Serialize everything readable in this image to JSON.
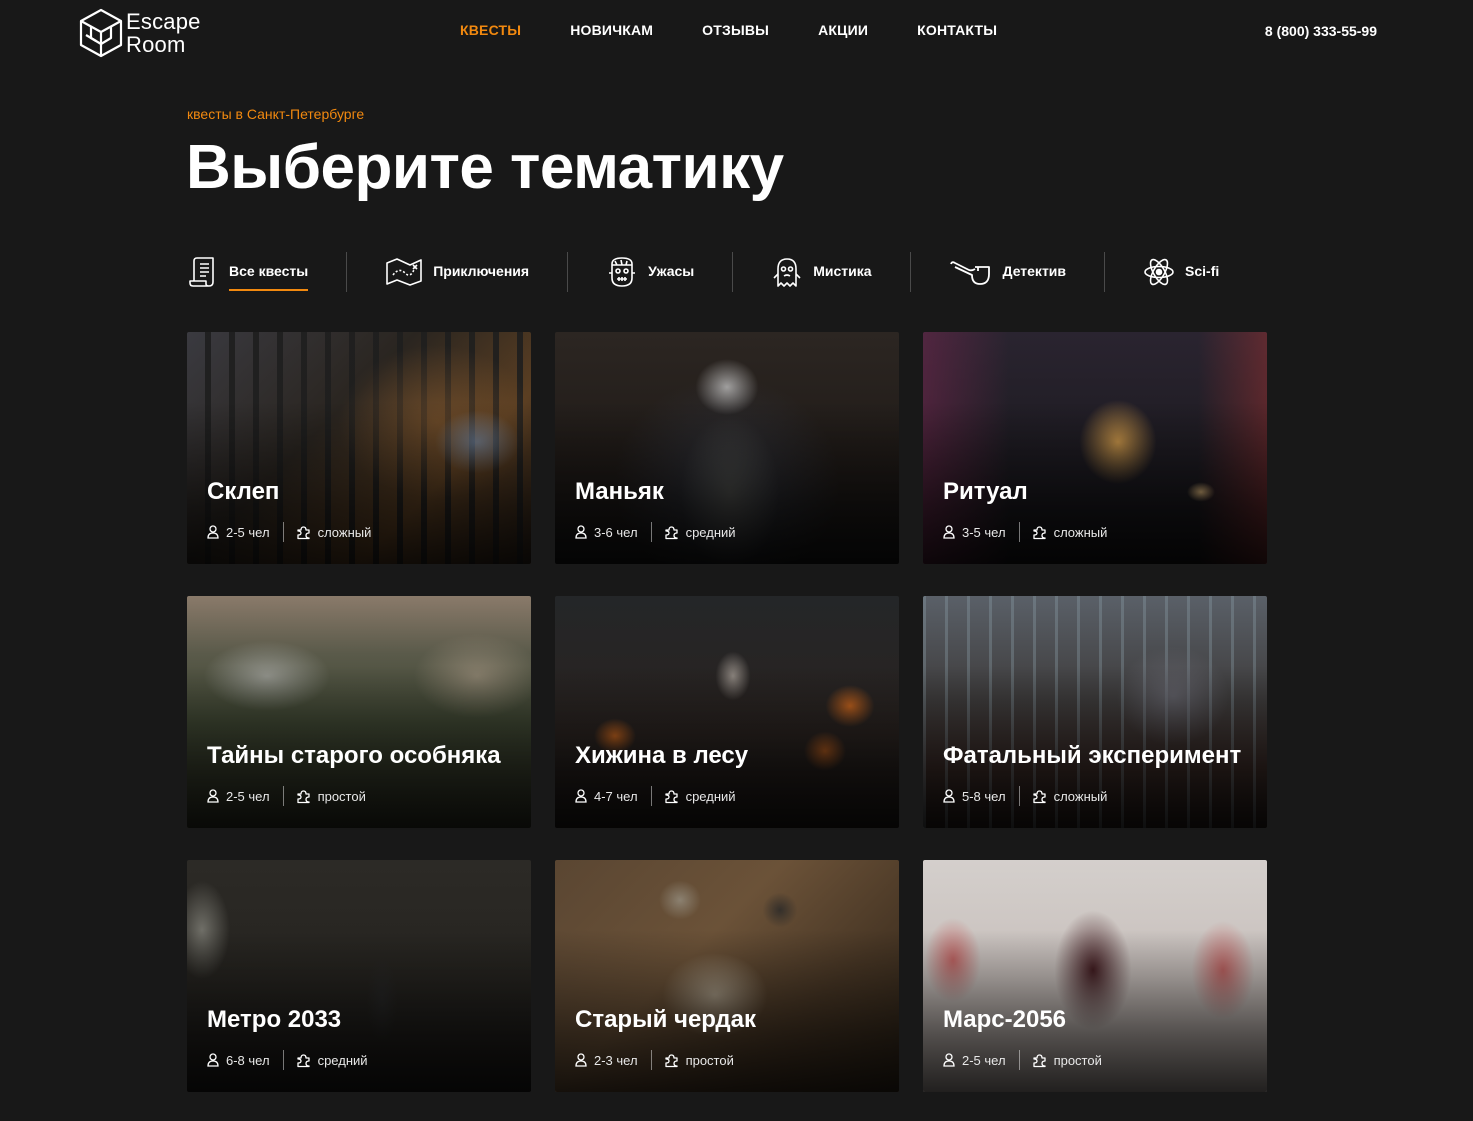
{
  "logo": {
    "line1": "Escape",
    "line2": "Room"
  },
  "nav": {
    "items": [
      {
        "label": "КВЕСТЫ"
      },
      {
        "label": "НОВИЧКАМ"
      },
      {
        "label": "ОТЗЫВЫ"
      },
      {
        "label": "АКЦИИ"
      },
      {
        "label": "КОНТАКТЫ"
      }
    ],
    "phone": "8 (800) 333-55-99"
  },
  "hero": {
    "kicker": "квесты в Санкт-Петербурге",
    "title": "Выберите тематику"
  },
  "filters": [
    {
      "label": "Все квесты",
      "icon": "scroll-icon"
    },
    {
      "label": "Приключения",
      "icon": "map-icon"
    },
    {
      "label": "Ужасы",
      "icon": "frankenstein-icon"
    },
    {
      "label": "Мистика",
      "icon": "ghost-icon"
    },
    {
      "label": "Детектив",
      "icon": "pipe-icon"
    },
    {
      "label": "Sci-fi",
      "icon": "atom-icon"
    }
  ],
  "cards": [
    {
      "title": "Склеп",
      "people": "2-5 чел",
      "level": "сложный"
    },
    {
      "title": "Маньяк",
      "people": "3-6 чел",
      "level": "средний"
    },
    {
      "title": "Ритуал",
      "people": "3-5 чел",
      "level": "сложный"
    },
    {
      "title": "Тайны старого особняка",
      "people": "2-5 чел",
      "level": "простой"
    },
    {
      "title": "Хижина в лесу",
      "people": "4-7 чел",
      "level": "средний"
    },
    {
      "title": "Фатальный эксперимент",
      "people": "5-8 чел",
      "level": "сложный"
    },
    {
      "title": "Метро 2033",
      "people": "6-8 чел",
      "level": "средний"
    },
    {
      "title": "Старый чердак",
      "people": "2-3 чел",
      "level": "простой"
    },
    {
      "title": "Марс-2056",
      "people": "2-5 чел",
      "level": "простой"
    }
  ],
  "colors": {
    "accent": "#f2890f",
    "background": "#181818"
  }
}
